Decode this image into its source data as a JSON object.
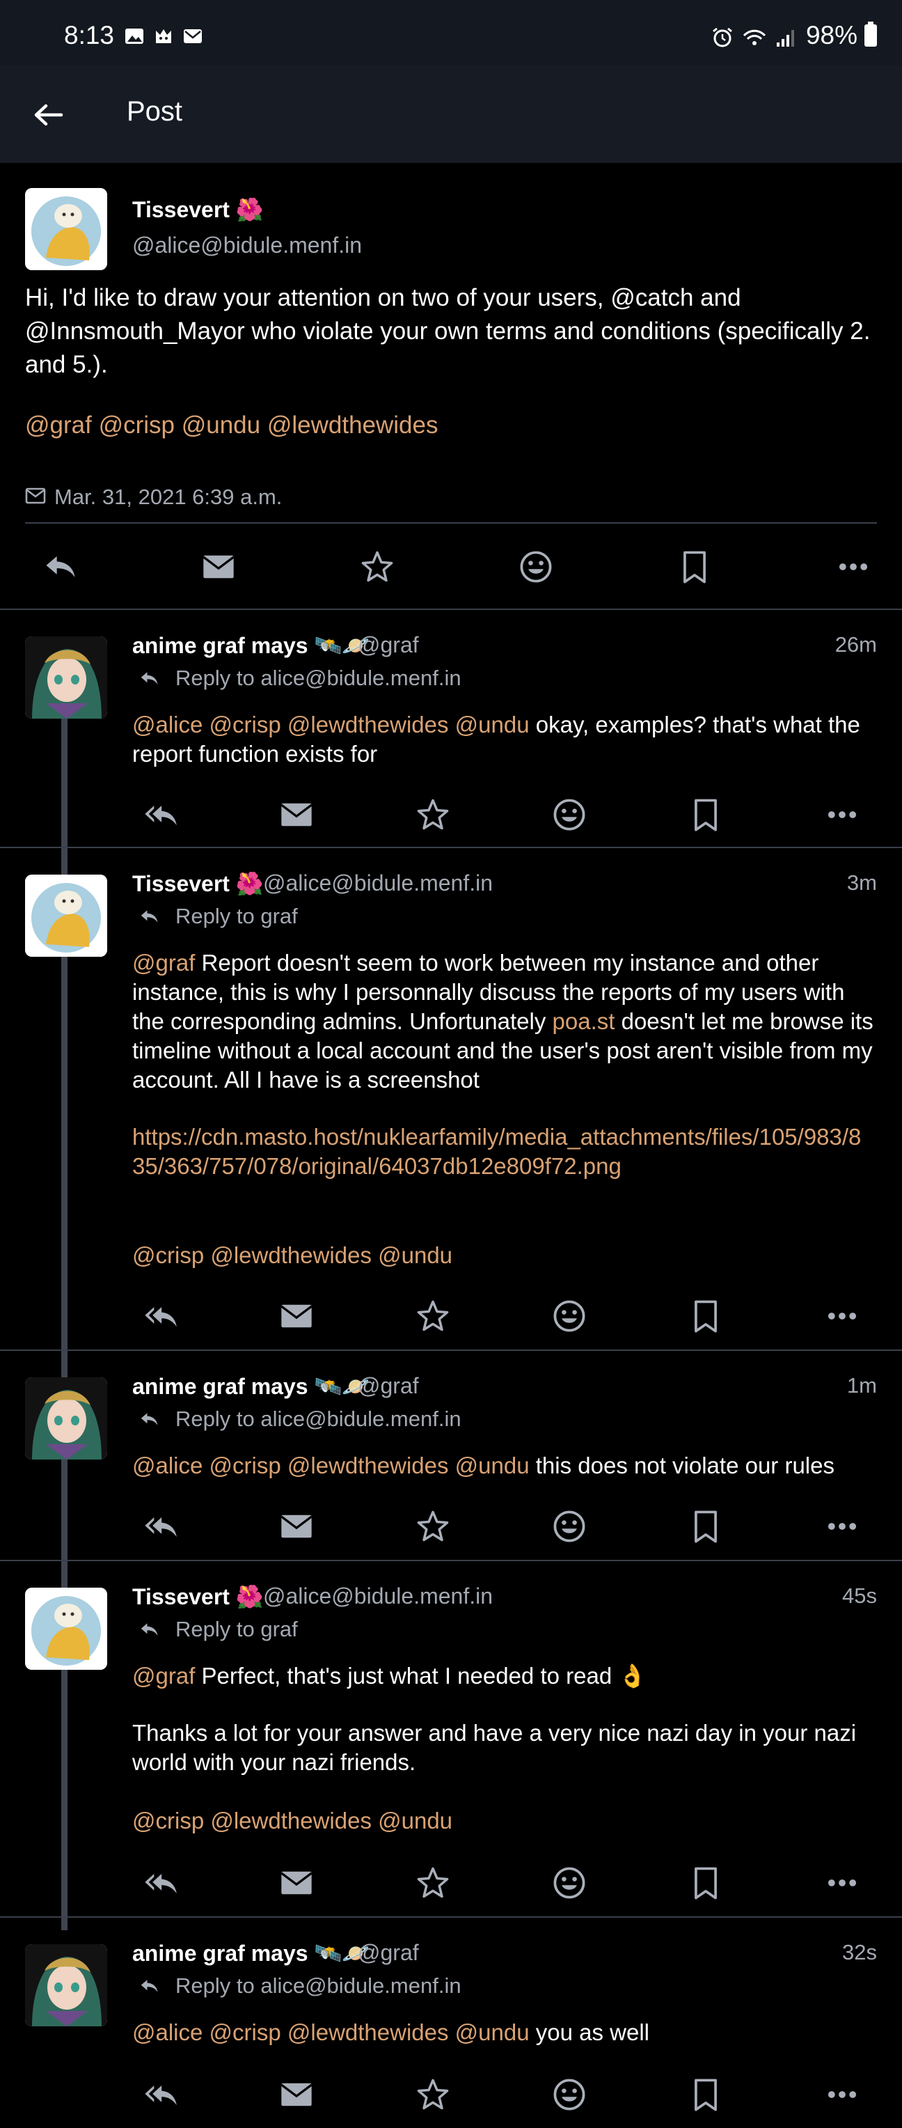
{
  "status_bar": {
    "time": "8:13",
    "battery": "98%"
  },
  "app_bar": {
    "title": "Post"
  },
  "main_post": {
    "author_name": "Tissevert 🌺",
    "author_handle": "@alice@bidule.menf.in",
    "body": "Hi, I'd like to draw your attention on two of your users, @catch and @Innsmouth_Mayor who violate your own terms and conditions (specifically 2. and 5.).",
    "mentions": "@graf @crisp @undu @lewdthewides",
    "date": "Mar. 31, 2021 6:39 a.m."
  },
  "replies": [
    {
      "name": "anime graf mays 🛰️🪐",
      "handle": "@graf",
      "time": "26m",
      "reply_to": "Reply to alice@bidule.menf.in",
      "mentions": "@alice @crisp @lewdthewides @undu",
      "body": " okay, examples? that's what the report function exists for"
    },
    {
      "name": "Tissevert 🌺",
      "handle": "@alice@bidule.menf.in",
      "time": "3m",
      "reply_to": "Reply to graf",
      "mention_lead": "@graf",
      "body1": " Report doesn't seem to work between my instance and other instance, this is why I personnally discuss the reports of my users with the corresponding admins. Unfortunately ",
      "inline_link": "poa.st",
      "body2": " doesn't let me browse its timeline without a local account and the user's post aren't visible from my account. All I have is a screenshot",
      "url": "https://cdn.masto.host/nuklearfamily/media_attachments/files/105/983/835/363/757/078/original/64037db12e809f72.png",
      "mentions": "@crisp @lewdthewides @undu"
    },
    {
      "name": "anime graf mays 🛰️🪐",
      "handle": "@graf",
      "time": "1m",
      "reply_to": "Reply to alice@bidule.menf.in",
      "mentions": "@alice @crisp @lewdthewides @undu",
      "body": " this does not violate our rules"
    },
    {
      "name": "Tissevert 🌺",
      "handle": "@alice@bidule.menf.in",
      "time": "45s",
      "reply_to": "Reply to graf",
      "mention_lead": "@graf",
      "body1": " Perfect, that's just what I needed to read 👌",
      "body2": "Thanks a lot for your answer and have a very nice nazi day in your nazi world with your nazi friends.",
      "mentions": "@crisp @lewdthewides @undu"
    },
    {
      "name": "anime graf mays 🛰️🪐",
      "handle": "@graf",
      "time": "32s",
      "reply_to": "Reply to alice@bidule.menf.in",
      "mentions": "@alice @crisp @lewdthewides @undu",
      "body": " you as well"
    }
  ],
  "icons": {
    "reply": "reply-icon",
    "reply_all": "reply-all-icon",
    "dm": "envelope-icon",
    "favourite": "star-icon",
    "react": "smiley-icon",
    "bookmark": "bookmark-icon",
    "more": "more-icon"
  }
}
